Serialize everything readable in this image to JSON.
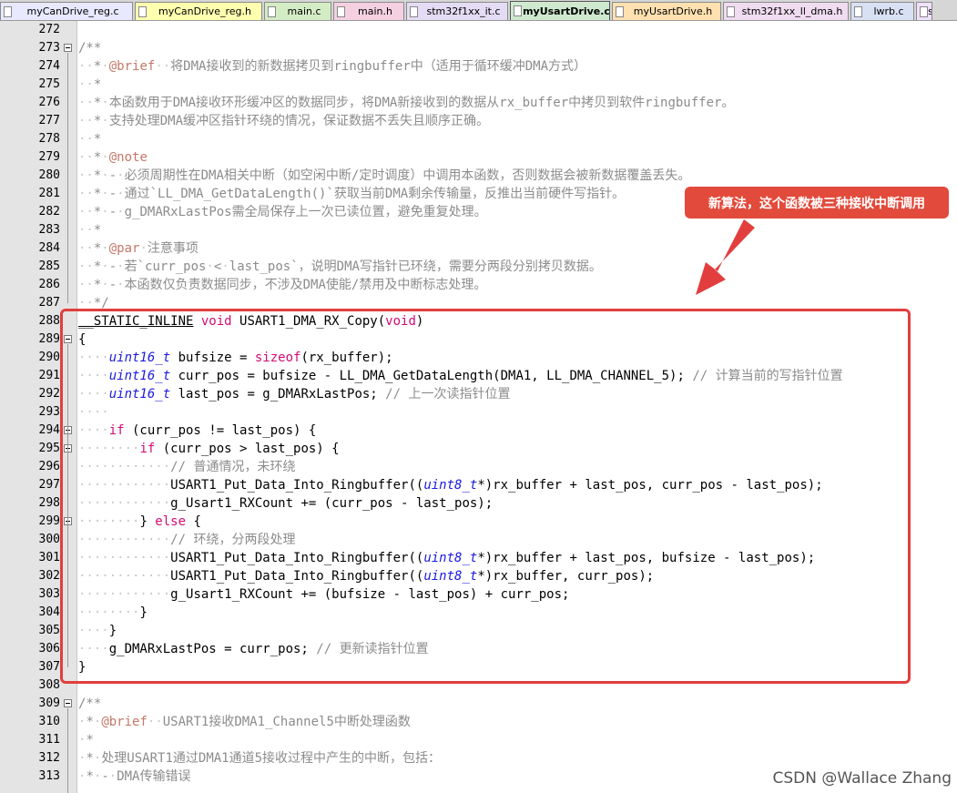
{
  "tabs": [
    {
      "label": "myCanDrive_reg.c",
      "color": "#e8e8ff",
      "active": false,
      "width": 146
    },
    {
      "label": "myCanDrive_reg.h",
      "color": "#ffffb0",
      "active": false,
      "width": 140
    },
    {
      "label": "main.c",
      "color": "#d4ecc4",
      "active": false,
      "width": 74
    },
    {
      "label": "main.h",
      "color": "#f4d0e0",
      "active": false,
      "width": 78
    },
    {
      "label": "stm32f1xx_it.c",
      "color": "#e4dcf4",
      "active": false,
      "width": 112
    },
    {
      "label": "myUsartDrive.c",
      "color": "#cfe9cf",
      "active": true,
      "width": 110
    },
    {
      "label": "myUsartDrive.h",
      "color": "#ffe0b0",
      "active": false,
      "width": 120
    },
    {
      "label": "stm32f1xx_ll_dma.h",
      "color": "#f0dcf0",
      "active": false,
      "width": 138
    },
    {
      "label": "lwrb.c",
      "color": "#d8e0f4",
      "active": false,
      "width": 70
    },
    {
      "label": "s",
      "color": "#f0e0ff",
      "active": false,
      "width": 18
    }
  ],
  "lines": [
    {
      "n": "272",
      "segs": []
    },
    {
      "n": "273",
      "fold": true,
      "segs": [
        [
          "cm",
          "/**"
        ]
      ]
    },
    {
      "n": "274",
      "segs": [
        [
          "ws",
          "··"
        ],
        [
          "cm",
          "*"
        ],
        [
          "ws",
          "·"
        ],
        [
          "tag",
          "@brief"
        ],
        [
          "ws",
          "··"
        ],
        [
          "cm",
          "将DMA接收到的新数据拷贝到ringbuffer中（适用于循环缓冲DMA方式）"
        ]
      ]
    },
    {
      "n": "275",
      "segs": [
        [
          "ws",
          "··"
        ],
        [
          "cm",
          "*"
        ]
      ]
    },
    {
      "n": "276",
      "segs": [
        [
          "ws",
          "··"
        ],
        [
          "cm",
          "*"
        ],
        [
          "ws",
          "·"
        ],
        [
          "cm",
          "本函数用于DMA接收环形缓冲区的数据同步，将DMA新接收到的数据从rx_buffer中拷贝到软件ringbuffer。"
        ]
      ]
    },
    {
      "n": "277",
      "segs": [
        [
          "ws",
          "··"
        ],
        [
          "cm",
          "*"
        ],
        [
          "ws",
          "·"
        ],
        [
          "cm",
          "支持处理DMA缓冲区指针环绕的情况，保证数据不丢失且顺序正确。"
        ]
      ]
    },
    {
      "n": "278",
      "segs": [
        [
          "ws",
          "··"
        ],
        [
          "cm",
          "*"
        ]
      ]
    },
    {
      "n": "279",
      "segs": [
        [
          "ws",
          "··"
        ],
        [
          "cm",
          "*"
        ],
        [
          "ws",
          "·"
        ],
        [
          "tag",
          "@note"
        ]
      ]
    },
    {
      "n": "280",
      "segs": [
        [
          "ws",
          "··"
        ],
        [
          "cm",
          "*"
        ],
        [
          "ws",
          "·"
        ],
        [
          "cm",
          "-"
        ],
        [
          "ws",
          "·"
        ],
        [
          "cm",
          "必须周期性在DMA相关中断（如空闲中断/定时调度）中调用本函数，否则数据会被新数据覆盖丢失。"
        ]
      ]
    },
    {
      "n": "281",
      "segs": [
        [
          "ws",
          "··"
        ],
        [
          "cm",
          "*"
        ],
        [
          "ws",
          "·"
        ],
        [
          "cm",
          "-"
        ],
        [
          "ws",
          "·"
        ],
        [
          "cm",
          "通过`LL_DMA_GetDataLength()`获取当前DMA剩余传输量，反推出当前硬件写指针。"
        ]
      ]
    },
    {
      "n": "282",
      "segs": [
        [
          "ws",
          "··"
        ],
        [
          "cm",
          "*"
        ],
        [
          "ws",
          "·"
        ],
        [
          "cm",
          "-"
        ],
        [
          "ws",
          "·"
        ],
        [
          "cm",
          "g_DMARxLastPos需全局保存上一次已读位置，避免重复处理。"
        ]
      ]
    },
    {
      "n": "283",
      "segs": [
        [
          "ws",
          "··"
        ],
        [
          "cm",
          "*"
        ]
      ]
    },
    {
      "n": "284",
      "segs": [
        [
          "ws",
          "··"
        ],
        [
          "cm",
          "*"
        ],
        [
          "ws",
          "·"
        ],
        [
          "tag",
          "@par"
        ],
        [
          "ws",
          "·"
        ],
        [
          "cm",
          "注意事项"
        ]
      ]
    },
    {
      "n": "285",
      "segs": [
        [
          "ws",
          "··"
        ],
        [
          "cm",
          "*"
        ],
        [
          "ws",
          "·"
        ],
        [
          "cm",
          "-"
        ],
        [
          "ws",
          "·"
        ],
        [
          "cm",
          "若`curr_pos"
        ],
        [
          "ws",
          "·"
        ],
        [
          "cm",
          "<"
        ],
        [
          "ws",
          "·"
        ],
        [
          "cm",
          "last_pos`，说明DMA写指针已环绕，需要分两段分别拷贝数据。"
        ]
      ]
    },
    {
      "n": "286",
      "segs": [
        [
          "ws",
          "··"
        ],
        [
          "cm",
          "*"
        ],
        [
          "ws",
          "·"
        ],
        [
          "cm",
          "-"
        ],
        [
          "ws",
          "·"
        ],
        [
          "cm",
          "本函数仅负责数据同步，不涉及DMA使能/禁用及中断标志处理。"
        ]
      ]
    },
    {
      "n": "287",
      "segs": [
        [
          "ws",
          "··"
        ],
        [
          "cm",
          "*/"
        ]
      ]
    },
    {
      "n": "288",
      "segs": [
        [
          "ul",
          "__STATIC_INLINE"
        ],
        [
          "txt",
          " "
        ],
        [
          "kw",
          "void"
        ],
        [
          "txt",
          " USART1_DMA_RX_Copy("
        ],
        [
          "kw",
          "void"
        ],
        [
          "txt",
          ")"
        ]
      ]
    },
    {
      "n": "289",
      "fold": true,
      "segs": [
        [
          "txt",
          "{"
        ]
      ]
    },
    {
      "n": "290",
      "segs": [
        [
          "ws",
          "····"
        ],
        [
          "ty",
          "uint16_t"
        ],
        [
          "txt",
          " bufsize = "
        ],
        [
          "kw",
          "sizeof"
        ],
        [
          "txt",
          "(rx_buffer);"
        ]
      ]
    },
    {
      "n": "291",
      "segs": [
        [
          "ws",
          "····"
        ],
        [
          "ty",
          "uint16_t"
        ],
        [
          "txt",
          " curr_pos = bufsize - LL_DMA_GetDataLength(DMA1, LL_DMA_CHANNEL_5); "
        ],
        [
          "cm",
          "// 计算当前的写指针位置"
        ]
      ]
    },
    {
      "n": "292",
      "segs": [
        [
          "ws",
          "····"
        ],
        [
          "ty",
          "uint16_t"
        ],
        [
          "txt",
          " last_pos = g_DMARxLastPos; "
        ],
        [
          "cm",
          "// 上一次读指针位置"
        ]
      ]
    },
    {
      "n": "293",
      "segs": [
        [
          "ws",
          "····"
        ]
      ]
    },
    {
      "n": "294",
      "fold": true,
      "segs": [
        [
          "ws",
          "····"
        ],
        [
          "kw",
          "if"
        ],
        [
          "txt",
          " (curr_pos != last_pos) {"
        ]
      ]
    },
    {
      "n": "295",
      "fold": true,
      "segs": [
        [
          "ws",
          "········"
        ],
        [
          "kw",
          "if"
        ],
        [
          "txt",
          " (curr_pos > last_pos) {"
        ]
      ]
    },
    {
      "n": "296",
      "segs": [
        [
          "ws",
          "············"
        ],
        [
          "cm",
          "// 普通情况，未环绕"
        ]
      ]
    },
    {
      "n": "297",
      "segs": [
        [
          "ws",
          "············"
        ],
        [
          "txt",
          "USART1_Put_Data_Into_Ringbuffer(("
        ],
        [
          "ty",
          "uint8_t"
        ],
        [
          "txt",
          "*)rx_buffer + last_pos, curr_pos - last_pos);"
        ]
      ]
    },
    {
      "n": "298",
      "segs": [
        [
          "ws",
          "············"
        ],
        [
          "txt",
          "g_Usart1_RXCount += (curr_pos - last_pos);"
        ]
      ]
    },
    {
      "n": "299",
      "fold": true,
      "segs": [
        [
          "ws",
          "········"
        ],
        [
          "txt",
          "} "
        ],
        [
          "kw",
          "else"
        ],
        [
          "txt",
          " {"
        ]
      ]
    },
    {
      "n": "300",
      "segs": [
        [
          "ws",
          "············"
        ],
        [
          "cm",
          "// 环绕，分两段处理"
        ]
      ]
    },
    {
      "n": "301",
      "segs": [
        [
          "ws",
          "············"
        ],
        [
          "txt",
          "USART1_Put_Data_Into_Ringbuffer(("
        ],
        [
          "ty",
          "uint8_t"
        ],
        [
          "txt",
          "*)rx_buffer + last_pos, bufsize - last_pos);"
        ]
      ]
    },
    {
      "n": "302",
      "segs": [
        [
          "ws",
          "············"
        ],
        [
          "txt",
          "USART1_Put_Data_Into_Ringbuffer(("
        ],
        [
          "ty",
          "uint8_t"
        ],
        [
          "txt",
          "*)rx_buffer, curr_pos);"
        ]
      ]
    },
    {
      "n": "303",
      "segs": [
        [
          "ws",
          "············"
        ],
        [
          "txt",
          "g_Usart1_RXCount += (bufsize - last_pos) + curr_pos;"
        ]
      ]
    },
    {
      "n": "304",
      "segs": [
        [
          "ws",
          "········"
        ],
        [
          "txt",
          "}"
        ]
      ]
    },
    {
      "n": "305",
      "segs": [
        [
          "ws",
          "····"
        ],
        [
          "txt",
          "}"
        ]
      ]
    },
    {
      "n": "306",
      "segs": [
        [
          "ws",
          "····"
        ],
        [
          "txt",
          "g_DMARxLastPos = curr_pos; "
        ],
        [
          "cm",
          "// 更新读指针位置"
        ]
      ]
    },
    {
      "n": "307",
      "segs": [
        [
          "txt",
          "}"
        ]
      ]
    },
    {
      "n": "308",
      "segs": []
    },
    {
      "n": "309",
      "fold": true,
      "segs": [
        [
          "cm",
          "/**"
        ]
      ]
    },
    {
      "n": "310",
      "segs": [
        [
          "ws",
          "·"
        ],
        [
          "cm",
          "*"
        ],
        [
          "ws",
          "·"
        ],
        [
          "tag",
          "@brief"
        ],
        [
          "ws",
          "··"
        ],
        [
          "cm",
          "USART1接收DMA1_Channel5中断处理函数"
        ]
      ]
    },
    {
      "n": "311",
      "segs": [
        [
          "ws",
          "·"
        ],
        [
          "cm",
          "*"
        ]
      ]
    },
    {
      "n": "312",
      "segs": [
        [
          "ws",
          "·"
        ],
        [
          "cm",
          "*"
        ],
        [
          "ws",
          "·"
        ],
        [
          "cm",
          "处理USART1通过DMA1通道5接收过程中产生的中断，包括："
        ]
      ]
    },
    {
      "n": "313",
      "segs": [
        [
          "ws",
          "·"
        ],
        [
          "cm",
          "*"
        ],
        [
          "ws",
          "·"
        ],
        [
          "cm",
          "-"
        ],
        [
          "ws",
          "·"
        ],
        [
          "cm",
          "DMA传输错误"
        ]
      ]
    }
  ],
  "callout": "新算法，这个函数被三种接收中断调用",
  "watermark": "CSDN @Wallace Zhang",
  "colors": {
    "annotation_red": "#e23e3e",
    "comment_gray": "#8c8c8c",
    "keyword_pink": "#d20b73",
    "type_blue": "#1b1be0"
  }
}
